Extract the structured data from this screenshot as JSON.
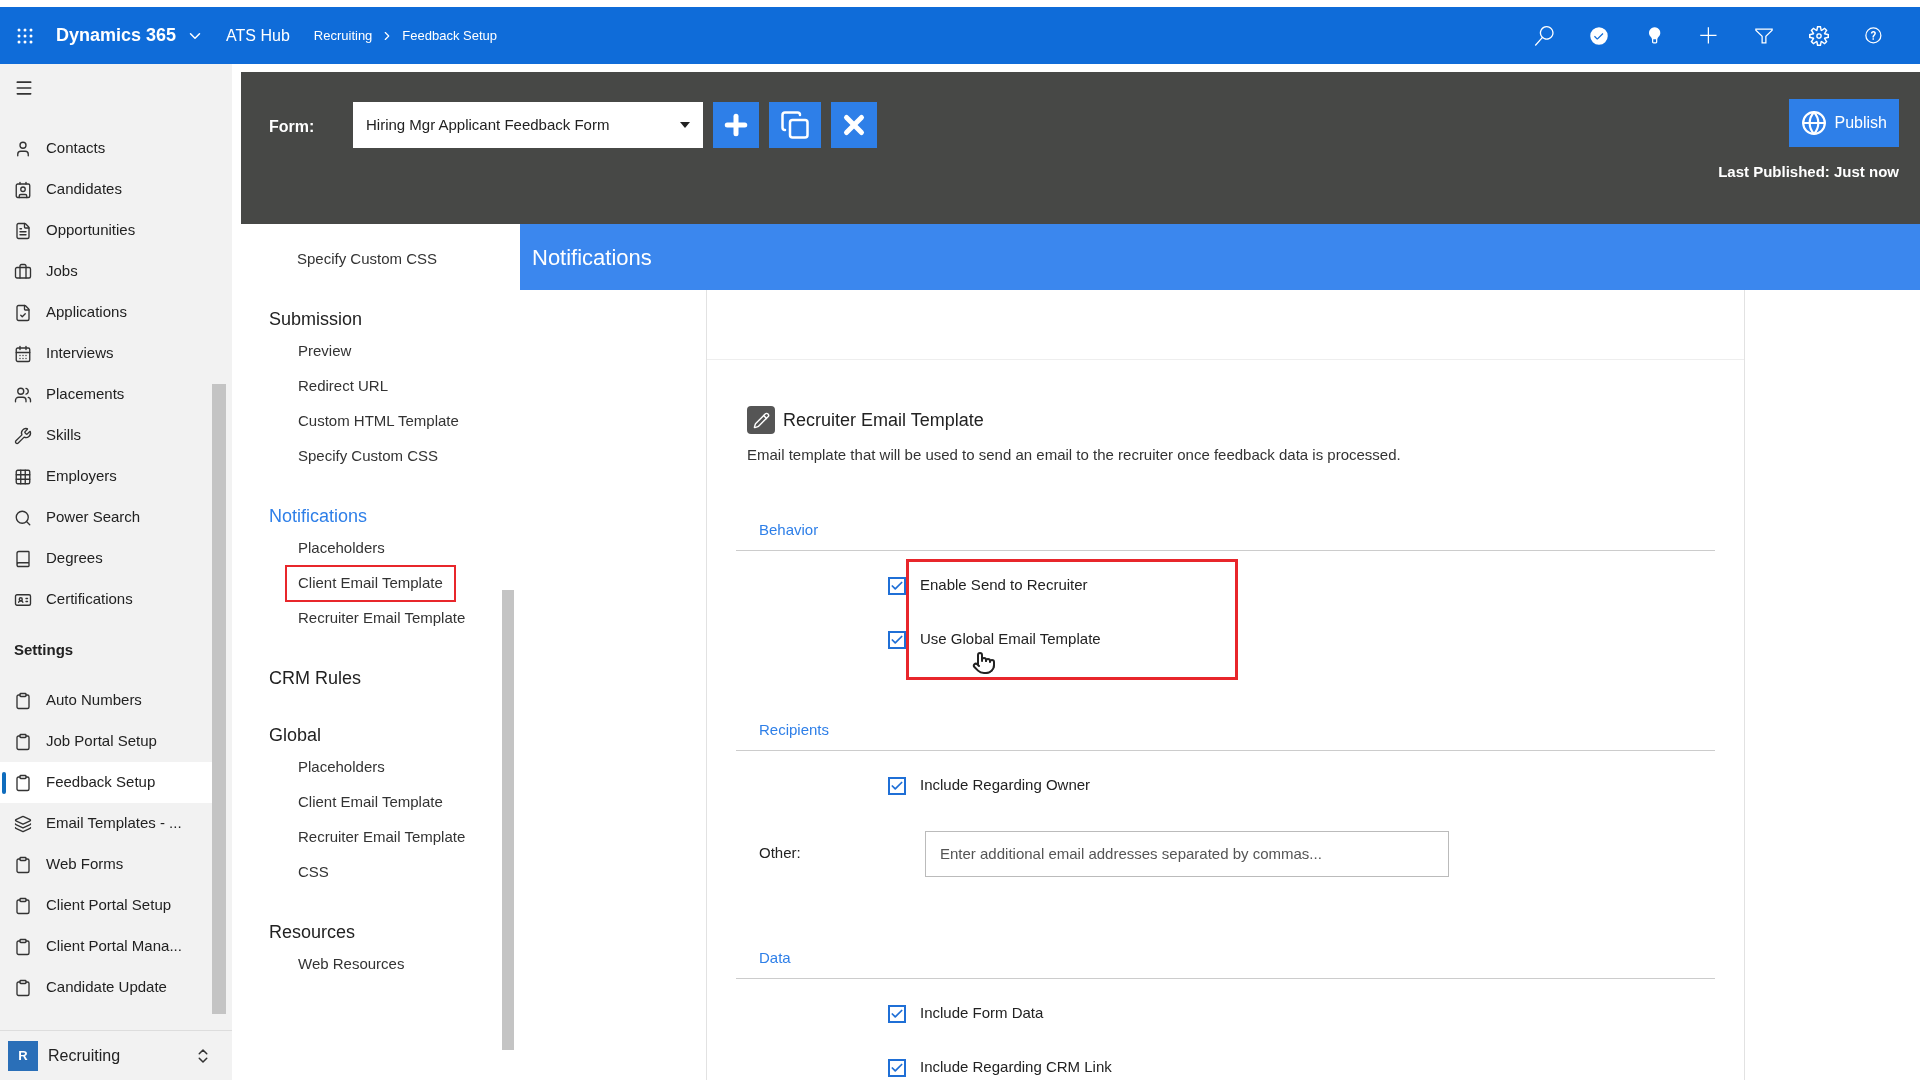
{
  "topbar": {
    "app_name": "Dynamics 365",
    "area": "ATS Hub",
    "breadcrumbs": [
      "Recruiting",
      "Feedback Setup"
    ]
  },
  "sidebar": {
    "items": [
      {
        "label": "Contacts",
        "selected": false
      },
      {
        "label": "Candidates",
        "selected": false
      },
      {
        "label": "Opportunities",
        "selected": false
      },
      {
        "label": "Jobs",
        "selected": false
      },
      {
        "label": "Applications",
        "selected": false
      },
      {
        "label": "Interviews",
        "selected": false
      },
      {
        "label": "Placements",
        "selected": false
      },
      {
        "label": "Skills",
        "selected": false
      },
      {
        "label": "Employers",
        "selected": false
      },
      {
        "label": "Power Search",
        "selected": false
      },
      {
        "label": "Degrees",
        "selected": false
      },
      {
        "label": "Certifications",
        "selected": false
      }
    ],
    "settings_heading": "Settings",
    "settings_items": [
      {
        "label": "Auto Numbers",
        "selected": false
      },
      {
        "label": "Job Portal Setup",
        "selected": false
      },
      {
        "label": "Feedback Setup",
        "selected": true
      },
      {
        "label": "Email Templates - ...",
        "selected": false
      },
      {
        "label": "Web Forms",
        "selected": false
      },
      {
        "label": "Client Portal Setup",
        "selected": false
      },
      {
        "label": "Client Portal Mana...",
        "selected": false
      },
      {
        "label": "Candidate Update",
        "selected": false
      }
    ],
    "area_switcher": {
      "badge": "R",
      "label": "Recruiting"
    }
  },
  "form_bar": {
    "label": "Form:",
    "form_value": "Hiring Mgr Applicant Feedback Form",
    "publish": "Publish",
    "last_published": "Last Published: Just now"
  },
  "nav": {
    "top_items": [
      {
        "label": "Specify Custom CSS",
        "highlighted": false
      }
    ],
    "sections": [
      {
        "title": "Submission",
        "selected": false,
        "items": [
          {
            "label": "Preview",
            "highlighted": false
          },
          {
            "label": "Redirect URL",
            "highlighted": false
          },
          {
            "label": "Custom HTML Template",
            "highlighted": false
          },
          {
            "label": "Specify Custom CSS",
            "highlighted": false
          }
        ]
      },
      {
        "title": "Notifications",
        "selected": true,
        "items": [
          {
            "label": "Placeholders",
            "highlighted": false
          },
          {
            "label": "Client Email Template",
            "highlighted": true
          },
          {
            "label": "Recruiter Email Template",
            "highlighted": false
          }
        ]
      },
      {
        "title": "CRM Rules",
        "selected": false
      },
      {
        "title": "Global",
        "selected": false,
        "items": [
          {
            "label": "Placeholders",
            "highlighted": false
          },
          {
            "label": "Client Email Template",
            "highlighted": false
          },
          {
            "label": "Recruiter Email Template",
            "highlighted": false
          },
          {
            "label": "CSS",
            "highlighted": false
          }
        ]
      },
      {
        "title": "Resources",
        "selected": false,
        "items": [
          {
            "label": "Web Resources",
            "highlighted": false
          }
        ]
      }
    ]
  },
  "panel": {
    "title": "Notifications",
    "card": {
      "title": "Recruiter Email Template",
      "description": "Email template that will be used to send an email to the recruiter once feedback data is processed.",
      "sections": [
        {
          "title": "Behavior",
          "highlighted": true,
          "rows": [
            {
              "kind": "checkbox",
              "label": "Enable Send to Recruiter",
              "checked": true
            },
            {
              "kind": "checkbox",
              "label": "Use Global Email Template",
              "checked": true
            }
          ]
        },
        {
          "title": "Recipients",
          "highlighted": false,
          "rows": [
            {
              "kind": "checkbox",
              "label": "Include Regarding Owner",
              "checked": true
            },
            {
              "kind": "text_field",
              "label": "Other:",
              "placeholder": "Enter additional email addresses separated by commas..."
            }
          ]
        },
        {
          "title": "Data",
          "highlighted": false,
          "rows": [
            {
              "kind": "checkbox",
              "label": "Include Form Data",
              "checked": true
            },
            {
              "kind": "checkbox",
              "label": "Include Regarding CRM Link",
              "checked": true
            }
          ]
        }
      ]
    }
  }
}
